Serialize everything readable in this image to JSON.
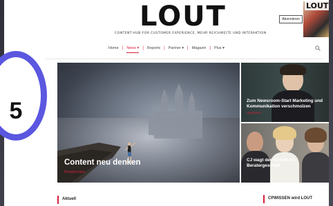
{
  "brand": {
    "logo": "LOUT",
    "tagline": "CONTENT-HUB FOR CUSTOMER EXPERIENCE, MEHR REICHWEITE UND INTERAKTION",
    "subscribe_label": "Abonnieren",
    "magazine_title": "LOUT"
  },
  "nav": {
    "items": [
      {
        "label": "Home"
      },
      {
        "label": "News ▾"
      },
      {
        "label": "Reports"
      },
      {
        "label": "Partner ▾"
      },
      {
        "label": "Magazin"
      },
      {
        "label": "Plus ▾"
      }
    ],
    "active_index": 1
  },
  "hero": {
    "title": "Content neu denken",
    "tag": "Kreativmodus"
  },
  "cards": [
    {
      "title": "Zum Newsroom-Start Marketing und Kommunikation verschmolzen",
      "tag": "Agenturen"
    },
    {
      "title": "CJ wagt den Schritt ins Beratergeschäft",
      "tag": ""
    }
  ],
  "sections": {
    "left": "Aktuell",
    "right": "CPWISSEN wird LOUT"
  },
  "badge": {
    "number": "5"
  },
  "colors": {
    "accent": "#d41f3b",
    "badge_ring": "#5b57e0"
  }
}
